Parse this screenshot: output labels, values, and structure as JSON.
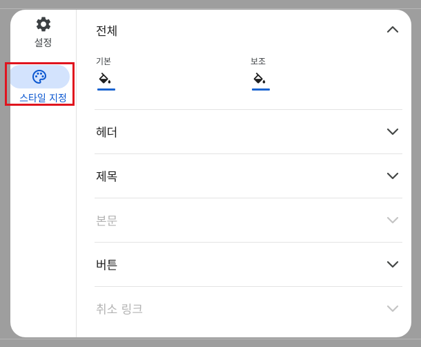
{
  "rail": {
    "settings": {
      "label": "설정",
      "icon": "gear-icon"
    },
    "styling": {
      "label": "스타일 지정",
      "icon": "palette-icon",
      "selected": true
    }
  },
  "sections": {
    "overall": {
      "title": "전체",
      "expanded": true,
      "primary": {
        "label": "기본",
        "icon": "fill-color-icon",
        "color": "#1a63d0"
      },
      "secondary": {
        "label": "보조",
        "icon": "fill-color-icon",
        "color": "#1a63d0"
      }
    },
    "header": {
      "title": "헤더",
      "disabled": false
    },
    "heading": {
      "title": "제목",
      "disabled": false
    },
    "body": {
      "title": "본문",
      "disabled": true
    },
    "button": {
      "title": "버튼",
      "disabled": false
    },
    "cancel_link": {
      "title": "취소 링크",
      "disabled": true
    }
  },
  "colors": {
    "accent": "#0b57d0",
    "selected_bg": "#d3e3fd",
    "highlight": "#e0141e"
  }
}
